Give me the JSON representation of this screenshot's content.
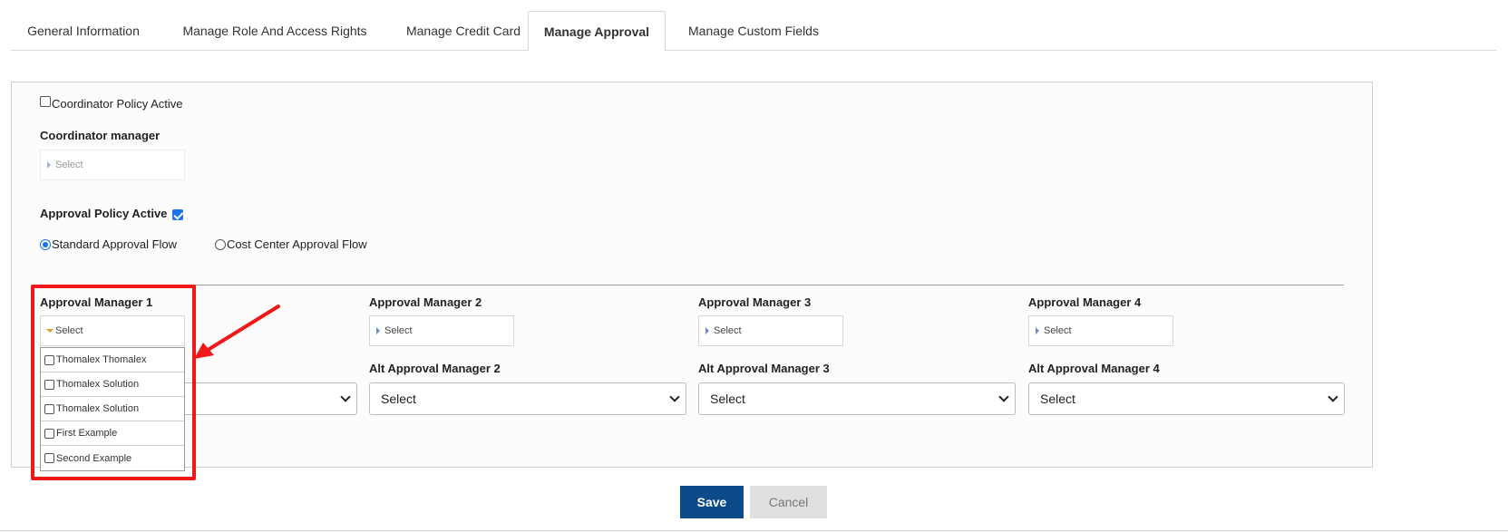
{
  "tabs": [
    {
      "label": "General Information",
      "active": false
    },
    {
      "label": "Manage Role And Access Rights",
      "active": false
    },
    {
      "label": "Manage Credit Card",
      "active": false
    },
    {
      "label": "Manage Approval",
      "active": true
    },
    {
      "label": "Manage Custom Fields",
      "active": false
    }
  ],
  "coordinator": {
    "policy_label": "Coordinator Policy Active",
    "policy_checked": false,
    "manager_label": "Coordinator manager",
    "manager_placeholder": "Select"
  },
  "approval": {
    "policy_label": "Approval Policy Active",
    "policy_checked": true,
    "flows": [
      {
        "label": "Standard Approval Flow",
        "selected": true
      },
      {
        "label": "Cost Center Approval Flow",
        "selected": false
      }
    ]
  },
  "managers": [
    {
      "label": "Approval Manager 1",
      "placeholder": "Select",
      "expanded": true
    },
    {
      "label": "Approval Manager 2",
      "placeholder": "Select",
      "expanded": false
    },
    {
      "label": "Approval Manager 3",
      "placeholder": "Select",
      "expanded": false
    },
    {
      "label": "Approval Manager 4",
      "placeholder": "Select",
      "expanded": false
    }
  ],
  "alt_managers": [
    {
      "label": "Alt Approval Manager 2",
      "value": "Select"
    },
    {
      "label": "Alt Approval Manager 3",
      "value": "Select"
    },
    {
      "label": "Alt Approval Manager 4",
      "value": "Select"
    }
  ],
  "dropdown_options": [
    "Thomalex Thomalex",
    "Thomalex Solution",
    "Thomalex Solution",
    "First Example",
    "Second Example"
  ],
  "buttons": {
    "save": "Save",
    "cancel": "Cancel"
  },
  "colors": {
    "highlight": "#f01818",
    "save_bg": "#0c4a8a",
    "checkbox_accent": "#1a73e8"
  }
}
